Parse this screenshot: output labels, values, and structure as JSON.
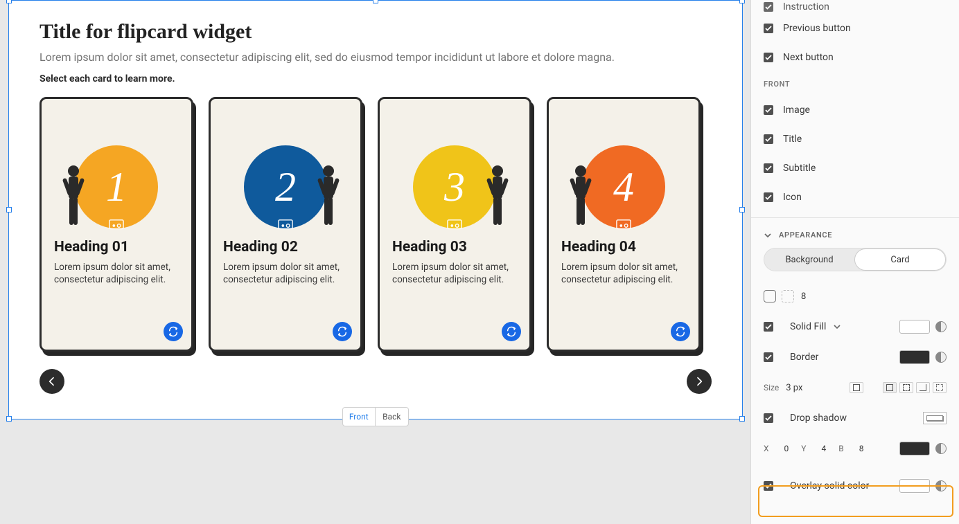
{
  "widget": {
    "title": "Title for flipcard widget",
    "subtitle": "Lorem ipsum dolor sit amet, consectetur adipiscing elit, sed do eiusmod tempor incididunt ut labore et dolore magna.",
    "instruction": "Select each card to learn more."
  },
  "cards": [
    {
      "num": "1",
      "heading": "Heading 01",
      "body": "Lorem ipsum dolor sit amet, consectetur adipiscing elit.",
      "circle_color": "#f5a623",
      "person_pos": "left"
    },
    {
      "num": "2",
      "heading": "Heading 02",
      "body": "Lorem ipsum dolor sit amet, consectetur adipiscing elit.",
      "circle_color": "#0f5a9c",
      "person_pos": "right"
    },
    {
      "num": "3",
      "heading": "Heading 03",
      "body": "Lorem ipsum dolor sit amet, consectetur adipiscing elit.",
      "circle_color": "#f0c419",
      "person_pos": "right"
    },
    {
      "num": "4",
      "heading": "Heading 04",
      "body": "Lorem ipsum dolor sit amet, consectetur adipiscing elit.",
      "circle_color": "#f06a23",
      "person_pos": "left"
    }
  ],
  "front_back": {
    "front": "Front",
    "back": "Back"
  },
  "panel": {
    "top_checks": [
      "Instruction",
      "Previous button",
      "Next button"
    ],
    "front_label": "FRONT",
    "front_checks": [
      "Image",
      "Title",
      "Subtitle",
      "Icon"
    ],
    "appearance_label": "APPEARANCE",
    "seg": {
      "bg": "Background",
      "card": "Card"
    },
    "corner_radius": "8",
    "solid_fill": "Solid Fill",
    "border": "Border",
    "size_label": "Size",
    "size_value": "3 px",
    "drop_shadow": "Drop shadow",
    "shadow": {
      "x_label": "X",
      "x_val": "0",
      "y_label": "Y",
      "y_val": "4",
      "b_label": "B",
      "b_val": "8"
    },
    "overlay": "Overlay solid color"
  }
}
